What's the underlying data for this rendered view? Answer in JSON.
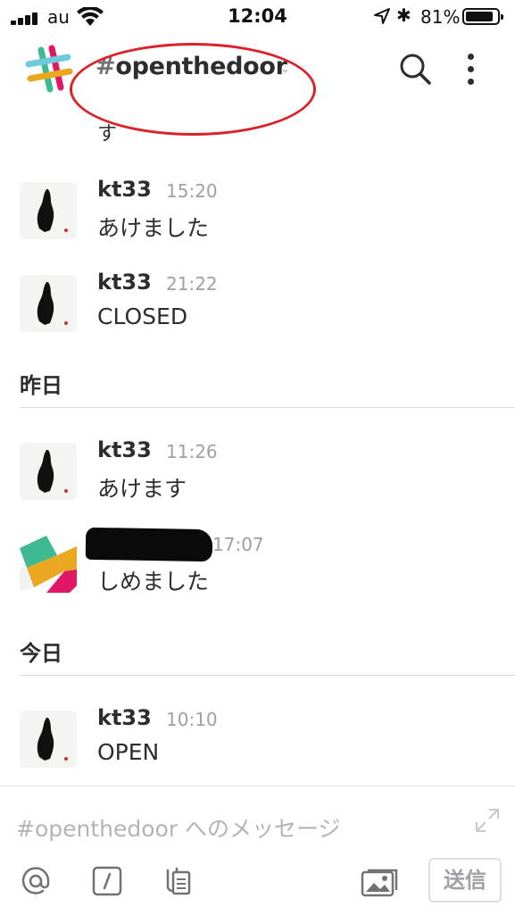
{
  "status": {
    "carrier": "au",
    "time": "12:04",
    "battery_pct": "81%",
    "battery_level": 0.81,
    "signal_bars": 4
  },
  "header": {
    "hash": "#",
    "channel": "openthedoor",
    "chevron": "⌄",
    "highlight_color": "#d9222a"
  },
  "feed": {
    "clipped_text": "す",
    "messages": [
      {
        "name": "kt33",
        "time": "15:20",
        "text": "あけました",
        "avatar": "ink-figure-avatar"
      },
      {
        "name": "kt33",
        "time": "21:22",
        "text": "CLOSED",
        "avatar": "ink-figure-avatar"
      }
    ],
    "day_yesterday": "昨日",
    "messages_yesterday": [
      {
        "name": "kt33",
        "time": "11:26",
        "text": "あけます",
        "avatar": "ink-figure-avatar"
      },
      {
        "name": "",
        "time": "17:07",
        "text": "しめました",
        "avatar": "slack-default-avatar"
      }
    ],
    "day_today": "今日",
    "messages_today": [
      {
        "name": "kt33",
        "time": "10:10",
        "text": "OPEN",
        "avatar": "ink-figure-avatar"
      }
    ]
  },
  "composer": {
    "placeholder": "#openthedoor へのメッセージ",
    "send_label": "送信",
    "tools": [
      "at-icon",
      "slash-command-icon",
      "attach-file-icon",
      "photo-icon"
    ]
  },
  "colors": {
    "accent_red": "#d9222a",
    "text": "#2c2d30",
    "muted": "#9e9ea6"
  }
}
